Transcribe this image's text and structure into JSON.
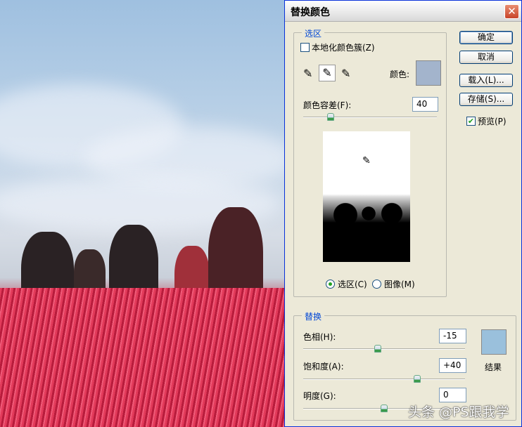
{
  "dialog": {
    "title": "替换颜色",
    "close_icon": "close-icon"
  },
  "buttons": {
    "ok": "确定",
    "cancel": "取消",
    "load": "载入(L)...",
    "save": "存储(S)..."
  },
  "preview": {
    "label": "预览(P)",
    "checked": true
  },
  "selection": {
    "legend": "选区",
    "localized_clusters": {
      "label": "本地化颜色簇(Z)",
      "checked": false
    },
    "eyedroppers": [
      "eyedropper-icon",
      "eyedropper-plus-icon",
      "eyedropper-minus-icon"
    ],
    "color_label": "颜色:",
    "color": "#a3b4cc",
    "fuzziness_label": "颜色容差(F):",
    "fuzziness_value": "40",
    "fuzziness": 40,
    "radio_selection": "选区(C)",
    "radio_image": "图像(M)",
    "selected": "选区(C)"
  },
  "replacement": {
    "legend": "替换",
    "hue_label": "色相(H):",
    "hue_value": "-15",
    "saturation_label": "饱和度(A):",
    "saturation_value": "+40",
    "lightness_label": "明度(G):",
    "lightness_value": "0",
    "result_label": "结果",
    "result_color": "#9ac0dc"
  },
  "watermark": "头条 @PS跟我学"
}
